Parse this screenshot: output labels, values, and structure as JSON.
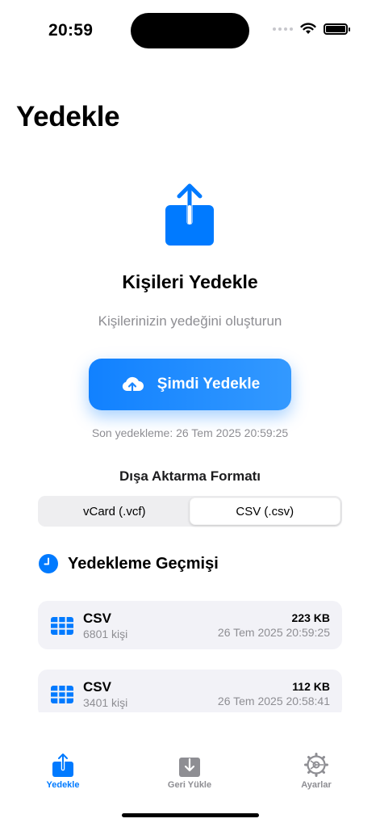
{
  "status_bar": {
    "time": "20:59"
  },
  "page": {
    "title": "Yedekle"
  },
  "hero": {
    "title": "Kişileri Yedekle",
    "subtitle": "Kişilerinizin yedeğini oluşturun",
    "icon": "share-upload-icon"
  },
  "backup_button": {
    "label": "Şimdi Yedekle",
    "icon": "cloud-upload-icon"
  },
  "last_backup": "Son yedekleme: 26 Tem 2025 20:59:25",
  "format": {
    "heading": "Dışa Aktarma Formatı",
    "options": [
      "vCard (.vcf)",
      "CSV (.csv)"
    ],
    "selected": "CSV (.csv)"
  },
  "history": {
    "title": "Yedekleme Geçmişi",
    "icon": "clock-icon",
    "items": [
      {
        "type": "CSV",
        "count": "6801 kişi",
        "size": "223 KB",
        "date": "26 Tem 2025 20:59:25"
      },
      {
        "type": "CSV",
        "count": "3401 kişi",
        "size": "112 KB",
        "date": "26 Tem 2025 20:58:41"
      }
    ]
  },
  "tabs": [
    {
      "label": "Yedekle",
      "icon": "upload-icon",
      "active": true
    },
    {
      "label": "Geri Yükle",
      "icon": "download-icon",
      "active": false
    },
    {
      "label": "Ayarlar",
      "icon": "gear-icon",
      "active": false
    }
  ],
  "colors": {
    "accent": "#007aff",
    "secondary_text": "#8e8e93",
    "card_bg": "#f2f2f7"
  }
}
